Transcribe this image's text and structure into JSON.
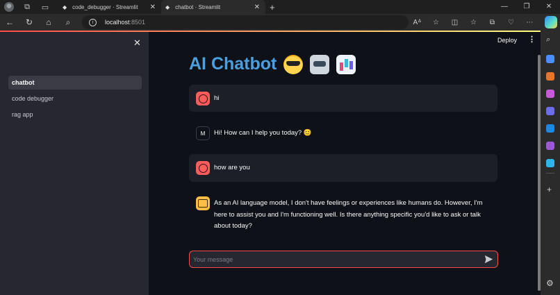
{
  "browser": {
    "tabs": [
      {
        "title": "code_debugger · Streamlit"
      },
      {
        "title": "chatbot · Streamlit"
      }
    ],
    "url": {
      "host": "localhost",
      "port": ":8501"
    }
  },
  "app": {
    "sidebar": {
      "items": [
        {
          "label": "chatbot"
        },
        {
          "label": "code debugger"
        },
        {
          "label": "rag app"
        }
      ]
    },
    "header": {
      "deploy_label": "Deploy"
    },
    "title": "AI Chatbot",
    "messages": [
      {
        "role": "user",
        "avatar_label": "",
        "text": "hi"
      },
      {
        "role": "assistant",
        "avatar_label": "M",
        "text": "Hi! How can I help you today? 😊"
      },
      {
        "role": "user",
        "avatar_label": "",
        "text": "how are you"
      },
      {
        "role": "assistant",
        "avatar_label": "",
        "text": "As an AI language model, I don't have feelings or experiences like humans do. However, I'm here to assist you and I'm functioning well. Is there anything specific you'd like to ask or talk about today?"
      }
    ],
    "chat_input": {
      "placeholder": "Your message"
    },
    "colors": {
      "accent": "#ff4b4b",
      "title": "#4a9fe0",
      "background": "#0e1117",
      "sidebar": "#262730"
    }
  }
}
